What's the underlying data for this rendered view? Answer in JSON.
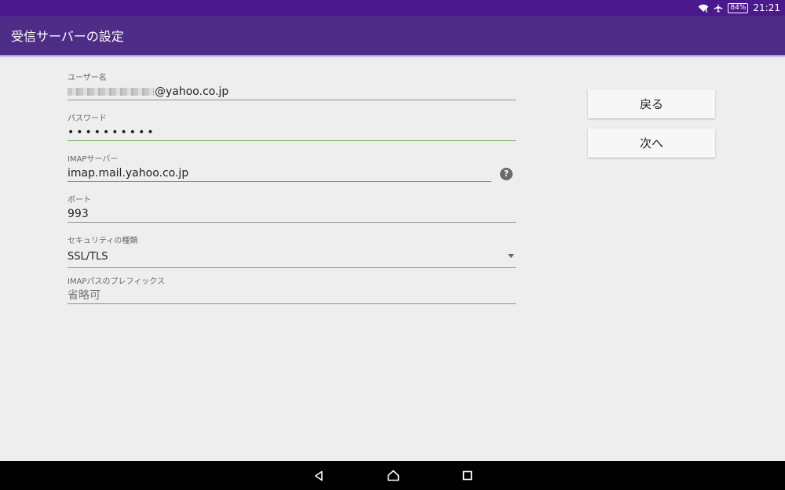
{
  "status_bar": {
    "battery": "84%",
    "time": "21:21",
    "icons": [
      "wifi-icon",
      "airplane-icon"
    ]
  },
  "app_bar": {
    "title": "受信サーバーの設定"
  },
  "form": {
    "username": {
      "label": "ユーザー名",
      "value_suffix": "@yahoo.co.jp"
    },
    "password": {
      "label": "パスワード",
      "value": "••••••••••"
    },
    "imap_server": {
      "label": "IMAPサーバー",
      "value": "imap.mail.yahoo.co.jp",
      "help_glyph": "?"
    },
    "port": {
      "label": "ポート",
      "value": "993"
    },
    "security": {
      "label": "セキュリティの種類",
      "value": "SSL/TLS"
    },
    "imap_prefix": {
      "label": "IMAPパスのプレフィックス",
      "placeholder": "省略可"
    }
  },
  "buttons": {
    "back": "戻る",
    "next": "次へ"
  },
  "nav": {
    "icons": [
      "back-icon",
      "home-icon",
      "recents-icon"
    ]
  },
  "colors": {
    "status_bar": "#4a1a8c",
    "app_bar": "#4e2d86",
    "focus_underline": "#6aa84f",
    "background": "#eeeeee"
  }
}
